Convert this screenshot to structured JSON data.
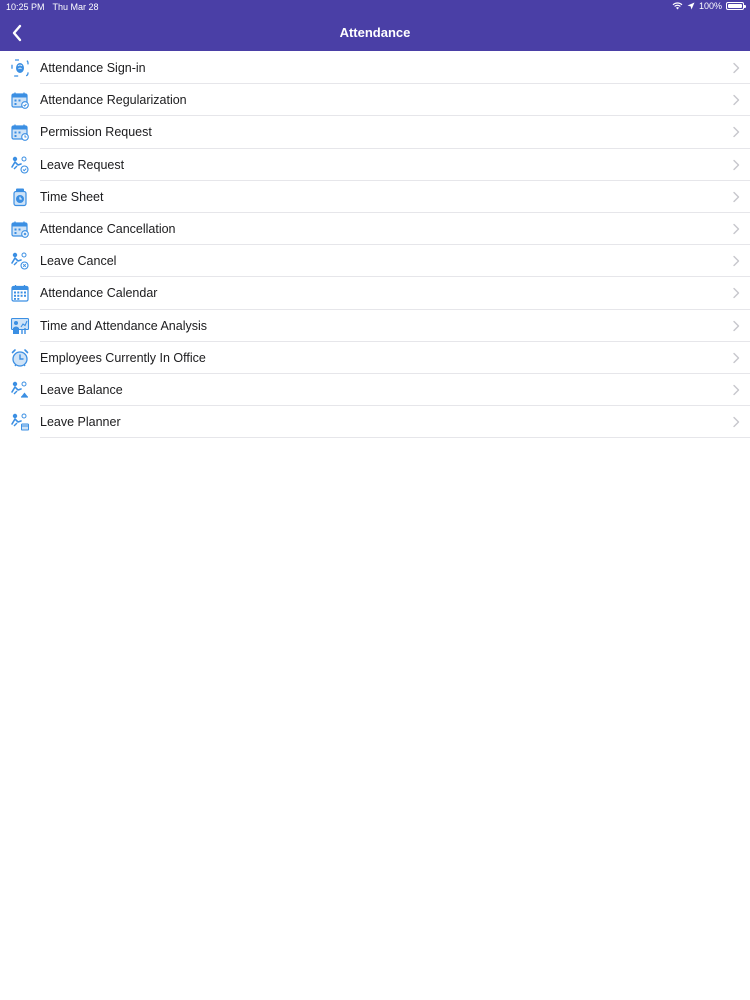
{
  "status_bar": {
    "time": "10:25 PM",
    "date": "Thu Mar 28",
    "battery_text": "100%",
    "battery_level": 1.0
  },
  "nav": {
    "title": "Attendance",
    "back_icon": "chevron-left-icon"
  },
  "colors": {
    "header_bg": "#4a3fa6",
    "icon_blue": "#3b8fe3",
    "chevron": "#c7c7cc"
  },
  "menu": {
    "items": [
      {
        "label": "Attendance Sign-in",
        "icon": "fingerprint-icon"
      },
      {
        "label": "Attendance Regularization",
        "icon": "calendar-edit-icon"
      },
      {
        "label": "Permission Request",
        "icon": "calendar-clock-icon"
      },
      {
        "label": "Leave Request",
        "icon": "leave-request-icon"
      },
      {
        "label": "Time Sheet",
        "icon": "timesheet-icon"
      },
      {
        "label": "Attendance Cancellation",
        "icon": "calendar-cancel-icon"
      },
      {
        "label": "Leave Cancel",
        "icon": "leave-cancel-icon"
      },
      {
        "label": "Attendance Calendar",
        "icon": "calendar-icon"
      },
      {
        "label": "Time and Attendance Analysis",
        "icon": "analysis-icon"
      },
      {
        "label": "Employees Currently In Office",
        "icon": "alarm-clock-icon"
      },
      {
        "label": "Leave Balance",
        "icon": "leave-balance-icon"
      },
      {
        "label": "Leave Planner",
        "icon": "leave-planner-icon"
      }
    ]
  }
}
